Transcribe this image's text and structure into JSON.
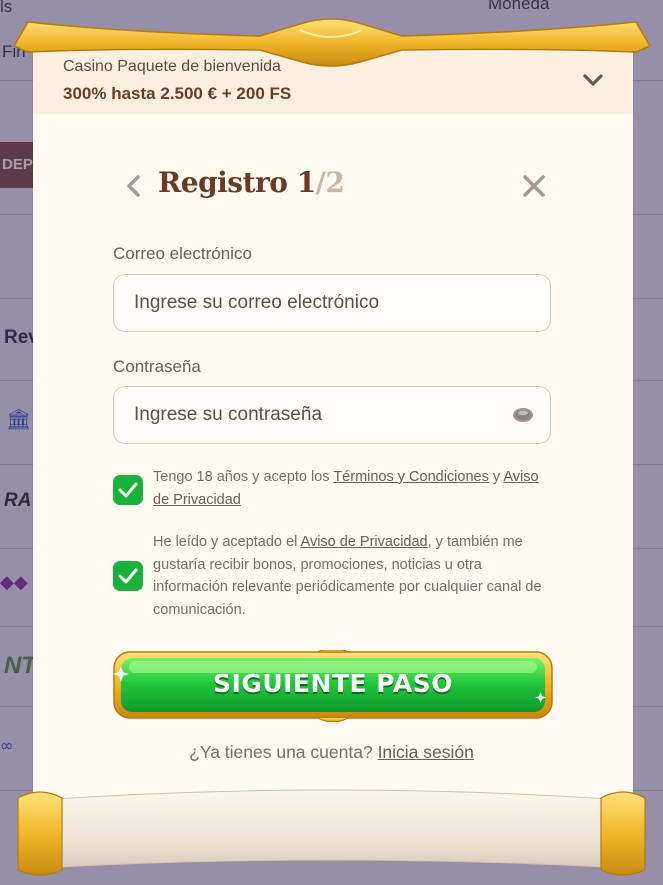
{
  "background": {
    "top_left_text": "ls",
    "top_right_text": "Moneda",
    "left_text": "Fin",
    "deposit_label": "DEPO",
    "logos": [
      "Rev",
      "RA",
      "NT"
    ]
  },
  "promo": {
    "subtitle": "Casino Paquete de bienvenida",
    "offer": "300% hasta 2.500 € + 200 FS"
  },
  "header": {
    "title": "Registro",
    "step": "1",
    "total": "/2"
  },
  "form": {
    "email": {
      "label": "Correo electrónico",
      "placeholder": "Ingrese su correo electrónico"
    },
    "password": {
      "label": "Contraseña",
      "placeholder": "Ingrese su contraseña"
    }
  },
  "consents": {
    "age": {
      "prefix": "Tengo 18 años y acepto los ",
      "terms_link": "Términos y Condiciones",
      "middle": " y ",
      "privacy_link": "Aviso de Privacidad",
      "checked": true
    },
    "marketing": {
      "prefix": "He leído y aceptado el ",
      "privacy_link": "Aviso de Privacidad",
      "suffix": ", y también me gustaría recibir bonos, promociones, noticias u otra información relevante periódicamente por cualquier canal de comunicación.",
      "checked": true
    }
  },
  "actions": {
    "next_label": "SIGUIENTE PASO",
    "have_account": "¿Ya tienes una cuenta?",
    "login_link": "Inicia sesión"
  },
  "colors": {
    "accent_green": "#19b23a",
    "title_brown": "#6b3a24",
    "gold": "#e8b21e",
    "modal_bg": "#fffaf2"
  }
}
